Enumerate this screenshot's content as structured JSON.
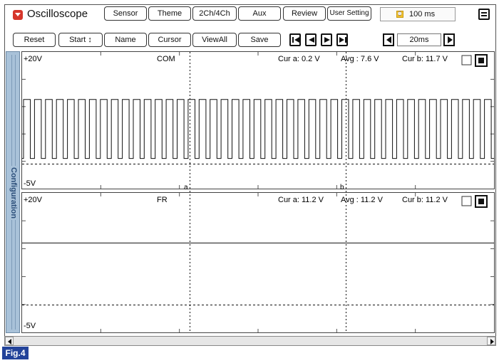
{
  "app": {
    "title": "Oscilloscope"
  },
  "toolbar_top": {
    "buttons": [
      "Sensor",
      "Theme",
      "2Ch/4Ch",
      "Aux",
      "Review",
      "User Setting"
    ],
    "time_display": "100 ms",
    "time_icon": "clock-icon"
  },
  "toolbar_bottom": {
    "buttons": [
      "Reset",
      "Start ↕",
      "Name",
      "Cursor",
      "ViewAll",
      "Save"
    ],
    "step_value": "20ms"
  },
  "side_tab": {
    "label": "Configuration"
  },
  "channels": [
    {
      "name": "COM",
      "max_label": "+20V",
      "min_label": "-5V",
      "cur_a": "Cur a: 0.2 V",
      "avg": "Avg : 7.6 V",
      "cur_b": "Cur b: 11.7 V",
      "cursor_a_label": "a",
      "cursor_b_label": "b",
      "signal": {
        "type": "square",
        "high_v": 11.7,
        "low_v": 0.2,
        "cycles": 43
      }
    },
    {
      "name": "FR",
      "max_label": "+20V",
      "min_label": "-5V",
      "cur_a": "Cur a: 11.2 V",
      "avg": "Avg : 11.2 V",
      "cur_b": "Cur b: 11.2 V",
      "signal": {
        "type": "flat",
        "level_v": 11.2
      }
    }
  ],
  "figure_label": "Fig.4",
  "colors": {
    "trace": "#111111",
    "side_tab": "#a9c2d9",
    "fig_badge": "#23439a",
    "close_icon": "#d6362b"
  }
}
